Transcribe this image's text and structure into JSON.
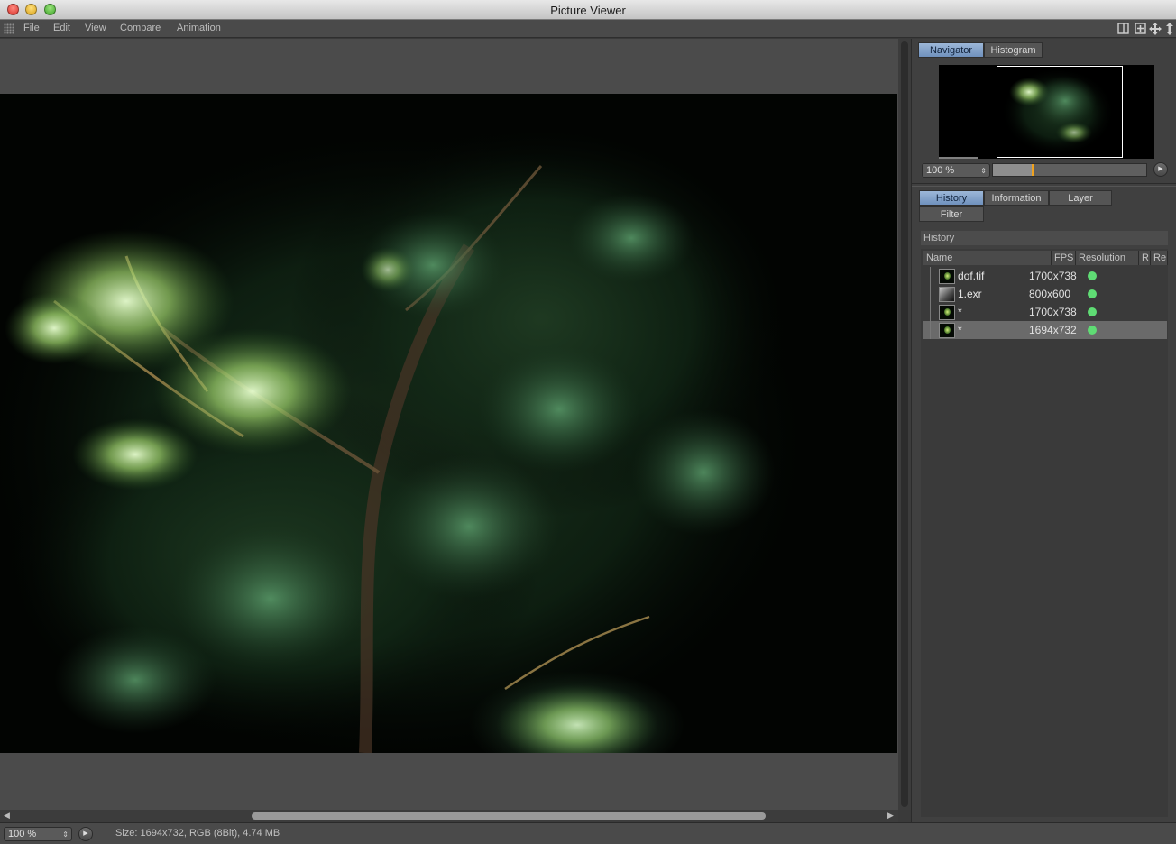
{
  "window": {
    "title": "Picture Viewer"
  },
  "menu": {
    "items": [
      "File",
      "Edit",
      "View",
      "Compare",
      "Animation"
    ]
  },
  "toolbar": {
    "icons": [
      "single-view-icon",
      "split-view-icon",
      "move-icon",
      "expand-icon"
    ]
  },
  "canvas": {
    "horizontal_scroll": 0.28
  },
  "navigator": {
    "tabs": [
      "Navigator",
      "Histogram"
    ],
    "active_tab": "Navigator",
    "zoom_value": "100 %",
    "slider_fill": 0.25
  },
  "history_panel": {
    "tabs": [
      "History",
      "Information",
      "Layer",
      "Filter"
    ],
    "active_tab": "History",
    "section_title": "History",
    "columns": [
      "Name",
      "FPS",
      "Resolution",
      "R",
      "Re"
    ],
    "rows": [
      {
        "name": "dof.tif",
        "resolution": "1700x738",
        "thumb": "tree",
        "status_color": "#5fdc74",
        "selected": false
      },
      {
        "name": "1.exr",
        "resolution": "800x600",
        "thumb": "exr",
        "status_color": "#5fdc74",
        "selected": false
      },
      {
        "name": "*",
        "resolution": "1700x738",
        "thumb": "tree",
        "status_color": "#5fdc74",
        "selected": false
      },
      {
        "name": "*",
        "resolution": "1694x732",
        "thumb": "tree",
        "status_color": "#5fdc74",
        "selected": true
      }
    ]
  },
  "status": {
    "zoom_value": "100 %",
    "info": "Size: 1694x732, RGB (8Bit), 4.74 MB"
  },
  "colors": {
    "accent_tab": "#7f9fc8",
    "status_ok": "#5fdc74",
    "slider_marker": "#f0a21e"
  }
}
